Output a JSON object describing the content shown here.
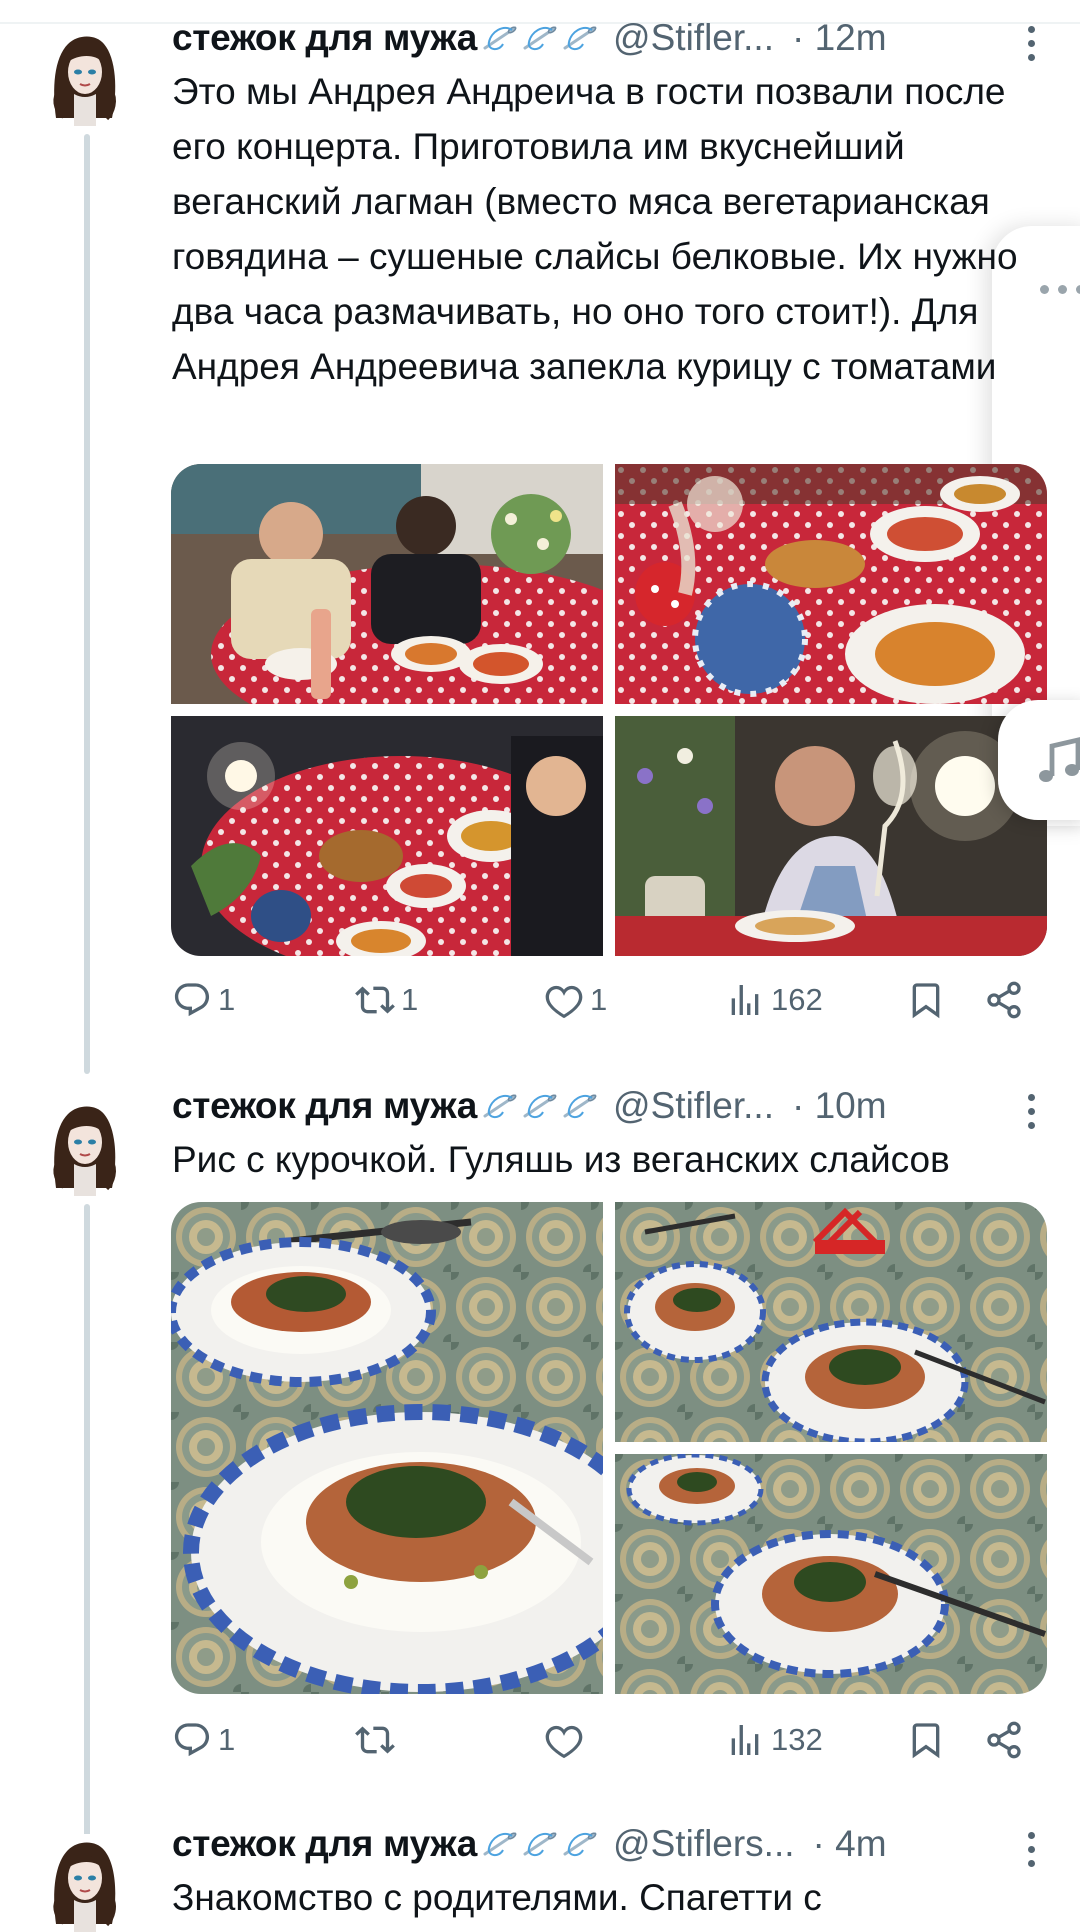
{
  "colors": {
    "text": "#0f1419",
    "secondary": "#536471",
    "thread": "#cfd9de",
    "accent": "#1d9bf0"
  },
  "tweets": [
    {
      "author": "стежок для мужа",
      "handle": "@Stifler...",
      "time": "· 12m",
      "text": "Это мы Андрея Андреича в гости позвали после его концерта. Приготовила им вкуснейший веганский лагман (вместо мяса вегетарианская говядина – сушеные слайсы белковые. Их нужно два часа размачивать, но оно того стоит!). Для Андрея Андреевича запекла курицу с томатами",
      "photos": [
        "guests-at-table",
        "table-with-teapot",
        "dinner-from-above",
        "woman-with-wine-glass"
      ],
      "stats": {
        "replies": "1",
        "reposts": "1",
        "likes": "1",
        "views": "162"
      }
    },
    {
      "author": "стежок для мужа",
      "handle": "@Stifler...",
      "time": "· 10m",
      "text": "Рис с курочкой. Гуляшь из веганских слайсов",
      "photos": [
        "rice-plates-close",
        "rice-plates-candle",
        "rice-plates-overhead"
      ],
      "stats": {
        "replies": "1",
        "reposts": "",
        "likes": "",
        "views": "132"
      }
    },
    {
      "author": "стежок для мужа",
      "handle": "@Stiflers...",
      "time": "· 4m",
      "text": "Знакомство с родителями. Спагетти с"
    }
  ],
  "icons": {
    "reply": "reply-icon",
    "repost": "repost-icon",
    "like": "heart-icon",
    "views": "views-icon",
    "bookmark": "bookmark-icon",
    "share": "share-icon",
    "more": "more-icon",
    "music": "music-note-icon",
    "needle": "needle-thread-icon"
  }
}
